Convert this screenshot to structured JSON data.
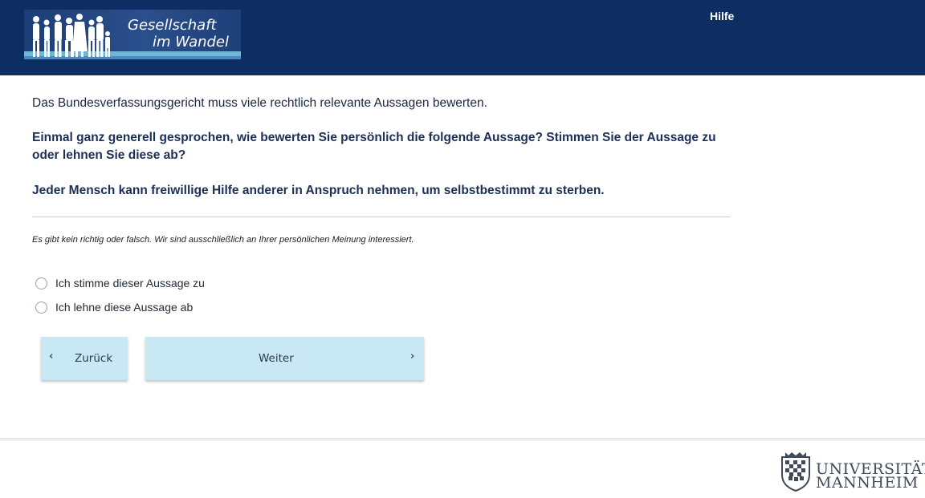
{
  "header": {
    "logo_line1": "Gesellschaft",
    "logo_line2": "im Wandel",
    "help_label": "Hilfe",
    "background": "#0d2d63"
  },
  "survey": {
    "intro": "Das Bundesverfassungsgericht muss viele rechtlich relevante Aussagen bewerten.",
    "question": "Einmal ganz generell gesprochen, wie bewerten Sie persönlich die folgende Aussage? Stimmen Sie der Aussage zu oder lehnen Sie diese ab?",
    "statement": "Jeder Mensch kann freiwillige Hilfe anderer in Anspruch nehmen, um selbstbestimmt zu sterben.",
    "note": "Es gibt kein richtig oder falsch. Wir sind ausschließlich an Ihrer persönlichen Meinung interessiert.",
    "options": [
      {
        "label": "Ich stimme dieser Aussage zu",
        "selected": false
      },
      {
        "label": "Ich lehne diese Aussage ab",
        "selected": false
      }
    ]
  },
  "nav": {
    "back_label": "Zurück",
    "back_icon": "chevron-left-icon",
    "next_label": "Weiter",
    "next_icon": "chevron-right-icon",
    "button_color": "#c8e8f3"
  },
  "footer": {
    "uni_line1": "UNIVERSITÄT",
    "uni_line2": "MANNHEIM"
  }
}
